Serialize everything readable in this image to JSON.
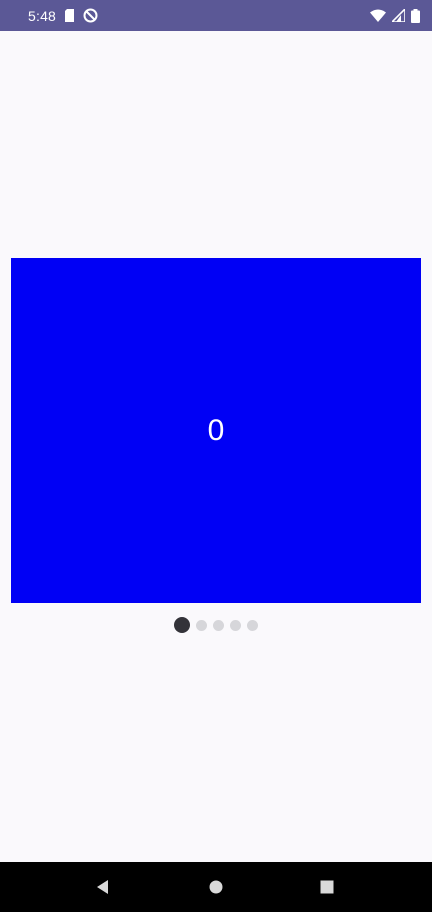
{
  "status_bar": {
    "time": "5:48",
    "background": "#5b5896",
    "left_icons": [
      "sim-card-icon",
      "data-saver-icon"
    ],
    "right_icons": [
      "wifi-icon",
      "cell-signal-icon",
      "battery-icon"
    ]
  },
  "pager": {
    "current_page_label": "0",
    "page_color": "#0000f5",
    "page_count": 5,
    "current_index": 0
  },
  "indicator": {
    "active_color": "#333339",
    "inactive_color": "#d6d6da"
  },
  "nav_bar": {
    "buttons": [
      "back-icon",
      "home-icon",
      "recents-icon"
    ],
    "background": "#000000"
  }
}
